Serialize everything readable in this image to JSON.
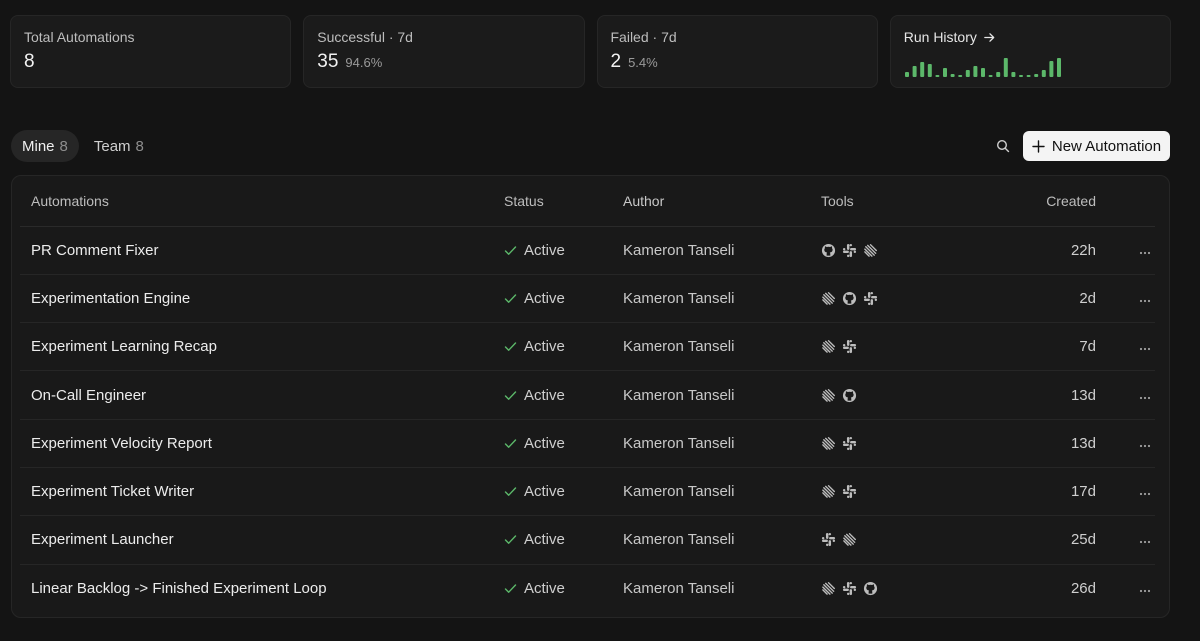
{
  "stats": {
    "total": {
      "label": "Total Automations",
      "value": "8"
    },
    "successful": {
      "label": "Successful · 7d",
      "value": "35",
      "pct": "94.6%"
    },
    "failed": {
      "label": "Failed · 7d",
      "value": "2",
      "pct": "5.4%"
    },
    "history": {
      "label": "Run History",
      "bars": [
        0.25,
        0.55,
        0.75,
        0.65,
        0.1,
        0.45,
        0.15,
        0.1,
        0.35,
        0.55,
        0.45,
        0.1,
        0.25,
        0.95,
        0.25,
        0.1,
        0.1,
        0.15,
        0.35,
        0.8,
        0.95
      ],
      "bar_color": "#5cb86a"
    }
  },
  "tabs": [
    {
      "label": "Mine",
      "count": "8",
      "active": true
    },
    {
      "label": "Team",
      "count": "8",
      "active": false
    }
  ],
  "new_button_label": "New Automation",
  "columns": {
    "name": "Automations",
    "status": "Status",
    "author": "Author",
    "tools": "Tools",
    "created": "Created"
  },
  "rows": [
    {
      "name": "PR Comment Fixer",
      "status": "Active",
      "author": "Kameron Tanseli",
      "tools": [
        "github",
        "slack",
        "linear"
      ],
      "created": "22h"
    },
    {
      "name": "Experimentation Engine",
      "status": "Active",
      "author": "Kameron Tanseli",
      "tools": [
        "linear",
        "github",
        "slack"
      ],
      "created": "2d"
    },
    {
      "name": "Experiment Learning Recap",
      "status": "Active",
      "author": "Kameron Tanseli",
      "tools": [
        "linear",
        "slack"
      ],
      "created": "7d"
    },
    {
      "name": "On-Call Engineer",
      "status": "Active",
      "author": "Kameron Tanseli",
      "tools": [
        "linear",
        "github"
      ],
      "created": "13d"
    },
    {
      "name": "Experiment Velocity Report",
      "status": "Active",
      "author": "Kameron Tanseli",
      "tools": [
        "linear",
        "slack"
      ],
      "created": "13d"
    },
    {
      "name": "Experiment Ticket Writer",
      "status": "Active",
      "author": "Kameron Tanseli",
      "tools": [
        "linear",
        "slack"
      ],
      "created": "17d"
    },
    {
      "name": "Experiment Launcher",
      "status": "Active",
      "author": "Kameron Tanseli",
      "tools": [
        "slack",
        "linear"
      ],
      "created": "25d"
    },
    {
      "name": "Linear Backlog -> Finished Experiment Loop",
      "status": "Active",
      "author": "Kameron Tanseli",
      "tools": [
        "linear",
        "slack",
        "github"
      ],
      "created": "26d"
    }
  ],
  "colors": {
    "status_check": "#5cb86a"
  }
}
